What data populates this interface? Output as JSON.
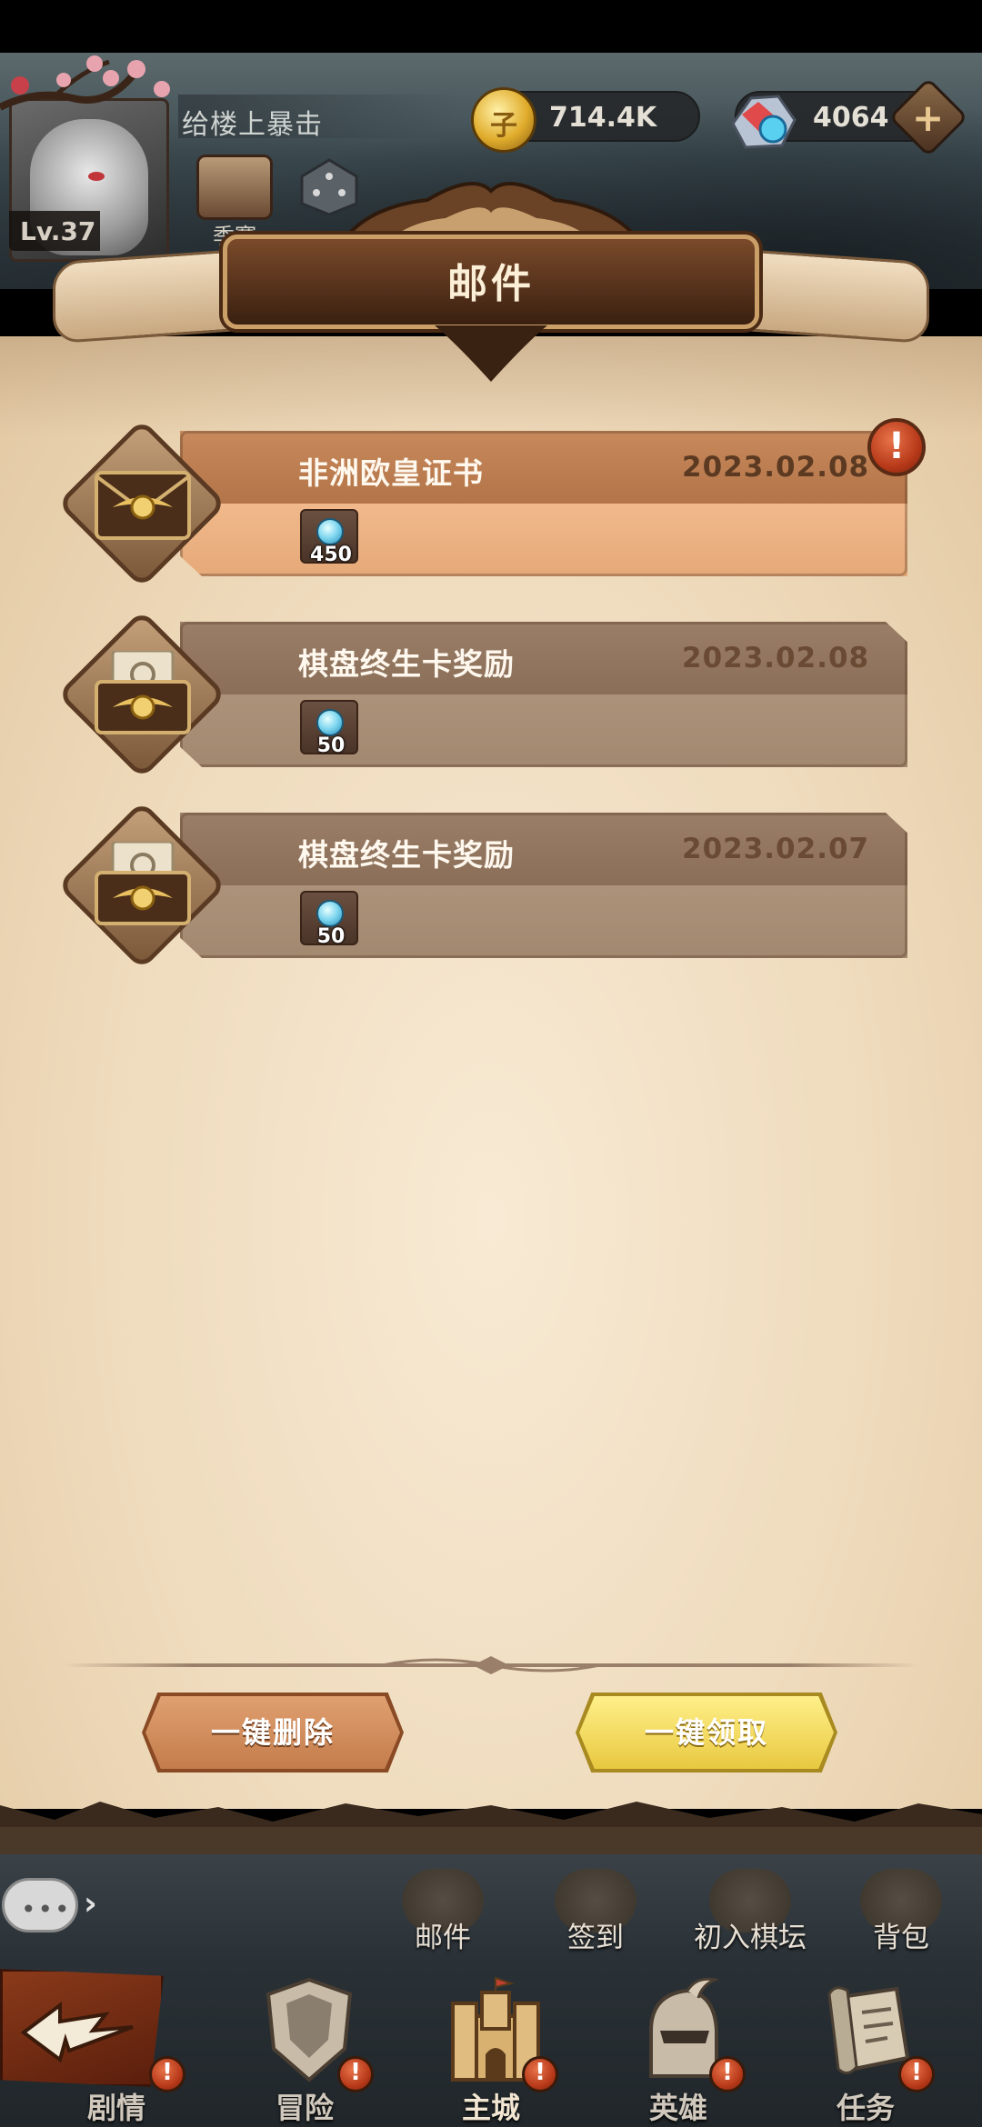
{
  "hud": {
    "player_name": "给楼上暴击",
    "level": "Lv.37",
    "gold": "714.4K",
    "gold_icon_glyph": "子",
    "gems": "4064",
    "plus_glyph": "+",
    "season_label": "季赛"
  },
  "title": "邮件",
  "mails": [
    {
      "subject": "非洲欧皇证书",
      "date": "2023.02.08",
      "reward_qty": "450",
      "status": "unread",
      "alert": "!"
    },
    {
      "subject": "棋盘终生卡奖励",
      "date": "2023.02.08",
      "reward_qty": "50",
      "status": "read"
    },
    {
      "subject": "棋盘终生卡奖励",
      "date": "2023.02.07",
      "reward_qty": "50",
      "status": "read"
    }
  ],
  "actions": {
    "delete_all": "一键删除",
    "claim_all": "一键领取"
  },
  "chat": {
    "dots": "•••",
    "arrow": "›"
  },
  "sub_nav": [
    {
      "label": "邮件",
      "icon": "mail-icon"
    },
    {
      "label": "签到",
      "icon": "checkin-scroll-icon"
    },
    {
      "label": "初入棋坛",
      "icon": "scroll-icon"
    },
    {
      "label": "背包",
      "icon": "backpack-icon"
    }
  ],
  "main_nav": [
    {
      "label": "剧情",
      "icon": "story-banner-icon",
      "alert": "!"
    },
    {
      "label": "冒险",
      "icon": "shield-icon",
      "alert": "!"
    },
    {
      "label": "主城",
      "icon": "castle-icon",
      "alert": "!"
    },
    {
      "label": "英雄",
      "icon": "helmet-icon",
      "alert": "!"
    },
    {
      "label": "任务",
      "icon": "quest-scroll-icon",
      "alert": "!"
    }
  ],
  "colors": {
    "panel": "#f3e3c8",
    "unread_card": "#e6a978",
    "read_card": "#a38870",
    "claim_button": "#f2dc5c",
    "delete_button": "#d08a5a",
    "alert_red": "#c0401c"
  }
}
